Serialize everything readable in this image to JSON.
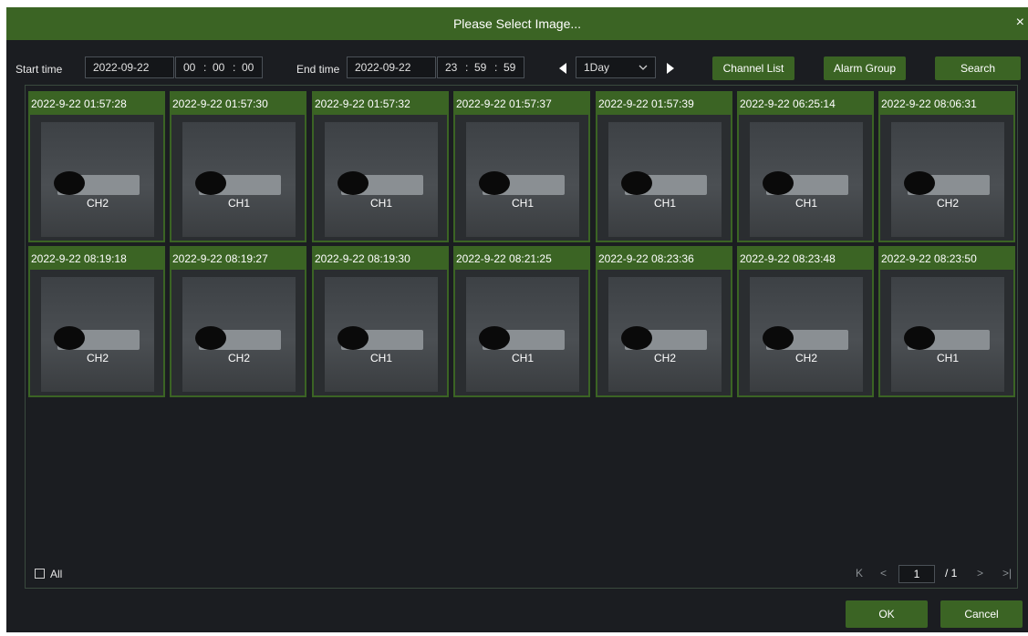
{
  "dialog": {
    "title": "Please Select Image...",
    "close_glyph": "×"
  },
  "filters": {
    "start_label": "Start time",
    "start_date": "2022-09-22",
    "start_h": "00",
    "start_m": "00",
    "start_s": "00",
    "end_label": "End time",
    "end_date": "2022-09-22",
    "end_h": "23",
    "end_m": "59",
    "end_s": "59",
    "time_sep": ":",
    "period": "1Day",
    "channel_list": "Channel List",
    "alarm_group": "Alarm Group",
    "search": "Search"
  },
  "images": [
    {
      "ts": "2022-9-22 01:57:28",
      "ch": "CH2"
    },
    {
      "ts": "2022-9-22 01:57:30",
      "ch": "CH1"
    },
    {
      "ts": "2022-9-22 01:57:32",
      "ch": "CH1"
    },
    {
      "ts": "2022-9-22 01:57:37",
      "ch": "CH1"
    },
    {
      "ts": "2022-9-22 01:57:39",
      "ch": "CH1"
    },
    {
      "ts": "2022-9-22 06:25:14",
      "ch": "CH1"
    },
    {
      "ts": "2022-9-22 08:06:31",
      "ch": "CH2"
    },
    {
      "ts": "2022-9-22 08:19:18",
      "ch": "CH2"
    },
    {
      "ts": "2022-9-22 08:19:27",
      "ch": "CH2"
    },
    {
      "ts": "2022-9-22 08:19:30",
      "ch": "CH1"
    },
    {
      "ts": "2022-9-22 08:21:25",
      "ch": "CH1"
    },
    {
      "ts": "2022-9-22 08:23:36",
      "ch": "CH2"
    },
    {
      "ts": "2022-9-22 08:23:48",
      "ch": "CH2"
    },
    {
      "ts": "2022-9-22 08:23:50",
      "ch": "CH1"
    }
  ],
  "footer": {
    "all_label": "All",
    "page_current": "1",
    "page_total": "/ 1",
    "ok": "OK",
    "cancel": "Cancel",
    "first_glyph": "K",
    "prev_glyph": "<",
    "next_glyph": ">",
    "last_glyph": ">|"
  },
  "colors": {
    "accent": "#3b6424",
    "background": "#1b1d21"
  }
}
